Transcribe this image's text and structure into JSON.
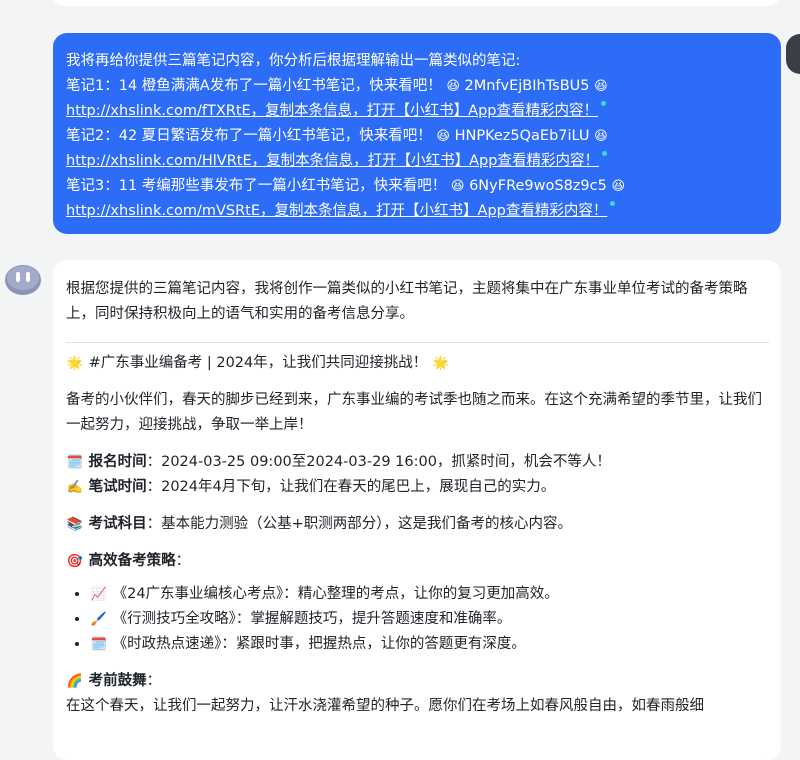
{
  "user_message": {
    "intro": "我将再给你提供三篇笔记内容，你分析后根据理解输出一篇类似的笔记:",
    "notes": [
      {
        "text": "笔记1：14 橙鱼满满A发布了一篇小红书笔记，快来看吧！",
        "code": "2MnfvEjBIhTsBU5",
        "link": "http://xhslink.com/fTXRtE，复制本条信息，打开【小红书】App查看精彩内容！"
      },
      {
        "text": "笔记2：42 夏日繁语发布了一篇小红书笔记，快来看吧！",
        "code": "HNPKez5QaEb7iLU",
        "link": "http://xhslink.com/HlVRtE，复制本条信息，打开【小红书】App查看精彩内容！"
      },
      {
        "text": "笔记3：11 考编那些事发布了一篇小红书笔记，快来看吧！",
        "code": "6NyFRe9woS8z9c5",
        "link": "http://xhslink.com/mVSRtE，复制本条信息，打开【小红书】App查看精彩内容！"
      }
    ],
    "emoji": "😆",
    "bubble_color": "#2d6cf6"
  },
  "assistant_message": {
    "intro": "根据您提供的三篇笔记内容，我将创作一篇类似的小红书笔记，主题将集中在广东事业单位考试的备考策略上，同时保持积极向上的语气和实用的备考信息分享。",
    "title_emoji": "🌟",
    "title": "#广东事业编备考 | 2024年，让我们共同迎接挑战！",
    "para1": "备考的小伙伴们，春天的脚步已经到来，广东事业编的考试季也随之而来。在这个充满希望的季节里，让我们一起努力，迎接挑战，争取一举上岸！",
    "signup_icon": "🗓️",
    "signup_label": "报名时间",
    "signup_text": "：2024-03-25 09:00至2024-03-29 16:00，抓紧时间，机会不等人！",
    "exam_icon": "✍️",
    "exam_label": "笔试时间",
    "exam_text": "：2024年4月下旬，让我们在春天的尾巴上，展现自己的实力。",
    "subject_icon": "📚",
    "subject_label": "考试科目",
    "subject_text": "：基本能力测验（公基+职测两部分），这是我们备考的核心内容。",
    "strategy_icon": "🎯",
    "strategy_label": "高效备考策略",
    "strategy_colon": "：",
    "strategies": [
      {
        "icon": "📈",
        "text": "《24广东事业编核心考点》：精心整理的考点，让你的复习更加高效。"
      },
      {
        "icon": "🖌️",
        "text": "《行测技巧全攻略》：掌握解题技巧，提升答题速度和准确率。"
      },
      {
        "icon": "🗓️",
        "text": "《时政热点速递》：紧跟时事，把握热点，让你的答题更有深度。"
      }
    ],
    "cheer_icon": "🌈",
    "cheer_label": "考前鼓舞",
    "cheer_colon": "：",
    "cheer_text": "在这个春天，让我们一起努力，让汗水浇灌希望的种子。愿你们在考场上如春风般自由，如春雨般细"
  }
}
